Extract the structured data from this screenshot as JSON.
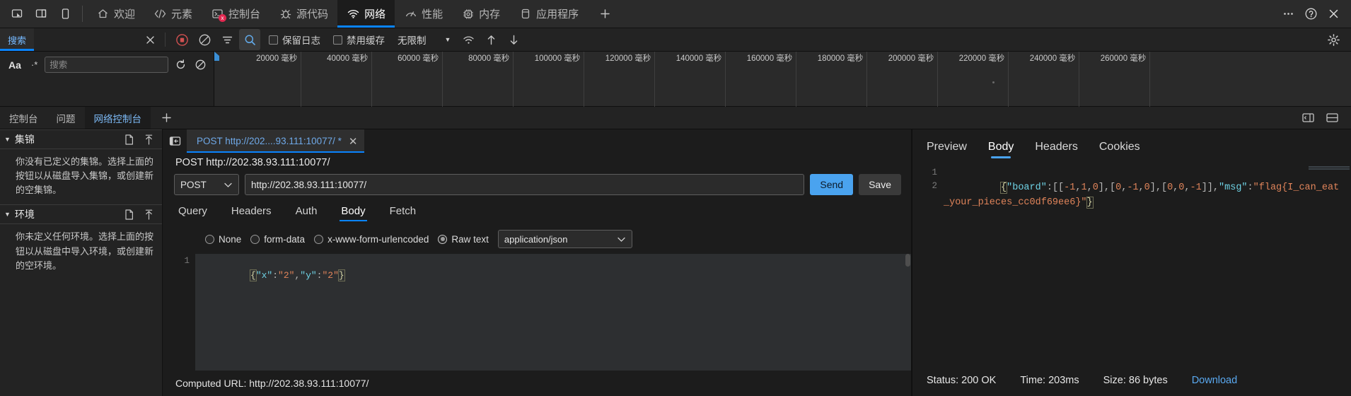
{
  "topbar": {
    "dock_buttons": [
      {
        "name": "dock-separate-window",
        "title": "独立窗口"
      },
      {
        "name": "dock-to-side",
        "title": "停靠到侧边"
      },
      {
        "name": "responsive-mode",
        "title": "响应式设计模式"
      }
    ],
    "tabs": [
      {
        "id": "welcome",
        "label": "欢迎",
        "icon": "home-icon",
        "active": false,
        "error": ""
      },
      {
        "id": "elements",
        "label": "元素",
        "icon": "code-brackets-icon",
        "active": false,
        "error": ""
      },
      {
        "id": "console",
        "label": "控制台",
        "icon": "terminal-icon",
        "active": false,
        "error": "x"
      },
      {
        "id": "sources",
        "label": "源代码",
        "icon": "bug-icon",
        "active": false,
        "error": ""
      },
      {
        "id": "network",
        "label": "网络",
        "icon": "wifi-icon",
        "active": true,
        "error": ""
      },
      {
        "id": "performance",
        "label": "性能",
        "icon": "gauge-icon",
        "active": false,
        "error": ""
      },
      {
        "id": "memory",
        "label": "内存",
        "icon": "chip-icon",
        "active": false,
        "error": ""
      },
      {
        "id": "application",
        "label": "应用程序",
        "icon": "database-icon",
        "active": false,
        "error": ""
      }
    ],
    "add_tab_label": "+",
    "more_label": "⋯",
    "help_label": "?",
    "close_label": "✕",
    "accent_color": "#0a84ff"
  },
  "network_toolbar": {
    "filter_tab_label": "搜索",
    "clear_search_label": "✕",
    "buttons": [
      {
        "name": "record-button",
        "icon": "record-icon",
        "selected": false
      },
      {
        "name": "clear-button",
        "icon": "no-entry-icon",
        "selected": false
      },
      {
        "name": "filter-button",
        "icon": "funnel-icon",
        "selected": false
      },
      {
        "name": "search-button",
        "icon": "magnifier-icon",
        "selected": true
      }
    ],
    "checkboxes": [
      {
        "name": "persist-logs",
        "label": "保留日志",
        "checked": false
      },
      {
        "name": "disable-cache",
        "label": "禁用缓存",
        "checked": false
      }
    ],
    "throttle_value": "无限制",
    "throttle_caret": "▼",
    "right_buttons": [
      {
        "name": "throttle-icon",
        "icon": "wifi-small-icon"
      },
      {
        "name": "upload-har-icon",
        "icon": "arrow-up-icon"
      },
      {
        "name": "download-har-icon",
        "icon": "arrow-down-icon"
      }
    ],
    "settings_icon": "gear-icon"
  },
  "search_panel": {
    "case_sensitive_label": "Aa",
    "regex_label": "·*",
    "input_placeholder": "搜索",
    "input_value": "",
    "refresh_icon": "refresh-icon",
    "clear_icon": "no-entry-icon"
  },
  "timeline": {
    "unit": "毫秒",
    "ticks": [
      "20000 毫秒",
      "40000 毫秒",
      "60000 毫秒",
      "80000 毫秒",
      "100000 毫秒",
      "120000 毫秒",
      "140000 毫秒",
      "160000 毫秒",
      "180000 毫秒",
      "200000 毫秒",
      "220000 毫秒",
      "240000 毫秒",
      "260000 毫秒"
    ]
  },
  "console_strip": {
    "tabs": [
      {
        "id": "console",
        "label": "控制台",
        "active": false
      },
      {
        "id": "issues",
        "label": "问题",
        "active": false
      },
      {
        "id": "network-console",
        "label": "网络控制台",
        "active": true
      }
    ],
    "add_label": "+",
    "right_buttons": [
      {
        "name": "split-console-icon",
        "icon": "split-icon"
      },
      {
        "name": "panel-layout-icon",
        "icon": "layout-icon"
      }
    ]
  },
  "sidebar": {
    "sections": [
      {
        "id": "collections",
        "triangle": "▼",
        "title": "集锦",
        "new_icon": "file-icon",
        "import_icon": "arrow-up-icon",
        "body": "你没有已定义的集锦。选择上面的按钮以从磁盘导入集锦，或创建新的空集锦。"
      },
      {
        "id": "environments",
        "triangle": "▼",
        "title": "环境",
        "new_icon": "file-icon",
        "import_icon": "arrow-up-icon",
        "body": "你未定义任何环境。选择上面的按钮以从磁盘中导入环境，或创建新的空环境。"
      }
    ]
  },
  "request": {
    "collapse_icon": "collapse-left-icon",
    "tab_label": "POST http://202....93.111:10077/ *",
    "tab_close": "✕",
    "title": "POST http://202.38.93.111:10077/",
    "method": "POST",
    "method_caret": "⌄",
    "url": "http://202.38.93.111:10077/",
    "send_label": "Send",
    "save_label": "Save",
    "subtabs": [
      {
        "id": "query",
        "label": "Query",
        "active": false
      },
      {
        "id": "headers",
        "label": "Headers",
        "active": false
      },
      {
        "id": "auth",
        "label": "Auth",
        "active": false
      },
      {
        "id": "body",
        "label": "Body",
        "active": true
      },
      {
        "id": "fetch",
        "label": "Fetch",
        "active": false
      }
    ],
    "body_types": [
      {
        "id": "none",
        "label": "None",
        "selected": false
      },
      {
        "id": "form-data",
        "label": "form-data",
        "selected": false
      },
      {
        "id": "x-www-form-urlencoded",
        "label": "x-www-form-urlencoded",
        "selected": false
      },
      {
        "id": "raw-text",
        "label": "Raw text",
        "selected": true
      }
    ],
    "mime_type": "application/json",
    "mime_caret": "⌄",
    "editor_line_number": "1",
    "editor_body": "{\"x\":\"2\",\"y\":\"2\"}",
    "computed_url_label": "Computed URL: http://202.38.93.111:10077/"
  },
  "response": {
    "tabs": [
      {
        "id": "preview",
        "label": "Preview",
        "active": false
      },
      {
        "id": "body",
        "label": "Body",
        "active": true
      },
      {
        "id": "headers",
        "label": "Headers",
        "active": false
      },
      {
        "id": "cookies",
        "label": "Cookies",
        "active": false
      }
    ],
    "line_numbers": [
      "1",
      "2"
    ],
    "body_text": "{\"board\":[[-1,1,0],[0,-1,0],[0,0,-1]],\"msg\":\"flag{I_can_eat_your_pieces_cc0df69ee6}\"}",
    "status": "Status: 200 OK",
    "time": "Time: 203ms",
    "size": "Size: 86 bytes",
    "download_label": "Download"
  }
}
